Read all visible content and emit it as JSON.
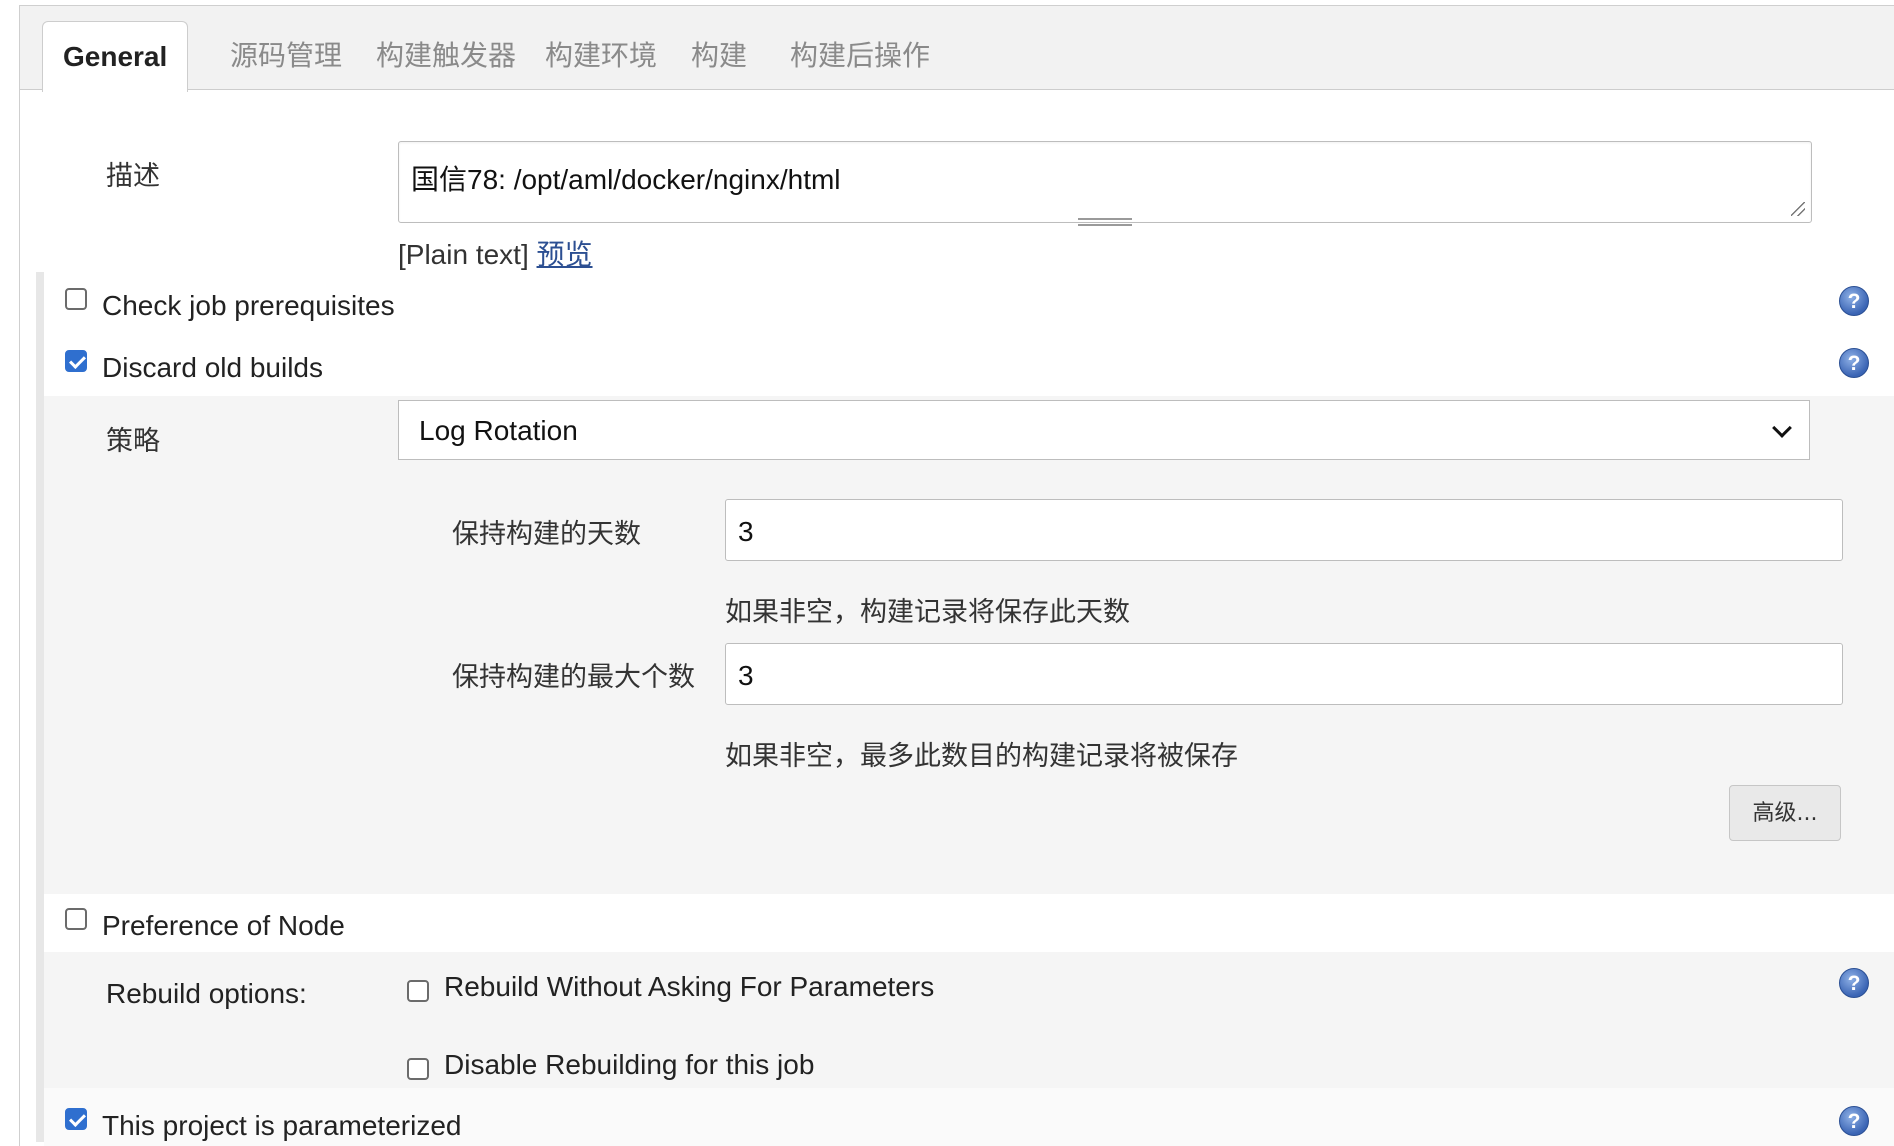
{
  "tabs": [
    {
      "label": "General",
      "active": true
    },
    {
      "label": "源码管理"
    },
    {
      "label": "构建触发器"
    },
    {
      "label": "构建环境"
    },
    {
      "label": "构建"
    },
    {
      "label": "构建后操作"
    }
  ],
  "description": {
    "label": "描述",
    "value": "国信78: /opt/aml/docker/nginx/html",
    "format": "[Plain text]",
    "preview_link": "预览"
  },
  "options": {
    "check_prereq": {
      "label": "Check job prerequisites",
      "checked": false
    },
    "discard_old": {
      "label": "Discard old builds",
      "checked": true
    },
    "preference_node": {
      "label": "Preference of Node",
      "checked": false
    },
    "parameterized": {
      "label": "This project is parameterized",
      "checked": true
    }
  },
  "strategy": {
    "label": "策略",
    "selected": "Log Rotation",
    "days_label": "保持构建的天数",
    "days_value": "3",
    "days_hint": "如果非空，构建记录将保存此天数",
    "max_label": "保持构建的最大个数",
    "max_value": "3",
    "max_hint": "如果非空，最多此数目的构建记录将被保存",
    "advanced_button": "高级..."
  },
  "rebuild": {
    "label": "Rebuild options:",
    "no_params": {
      "label": "Rebuild Without Asking For Parameters",
      "checked": false
    },
    "disable": {
      "label": "Disable Rebuilding for this job",
      "checked": false
    }
  },
  "colors": {
    "accent": "#2f6fcf",
    "link": "#2c4f92",
    "help_icon": "#3a64b4",
    "section_bg": "#f5f5f5"
  },
  "icons": {
    "help": "question-circle-icon",
    "select": "chevron-down-icon",
    "resize": "resize-grip-icon"
  }
}
